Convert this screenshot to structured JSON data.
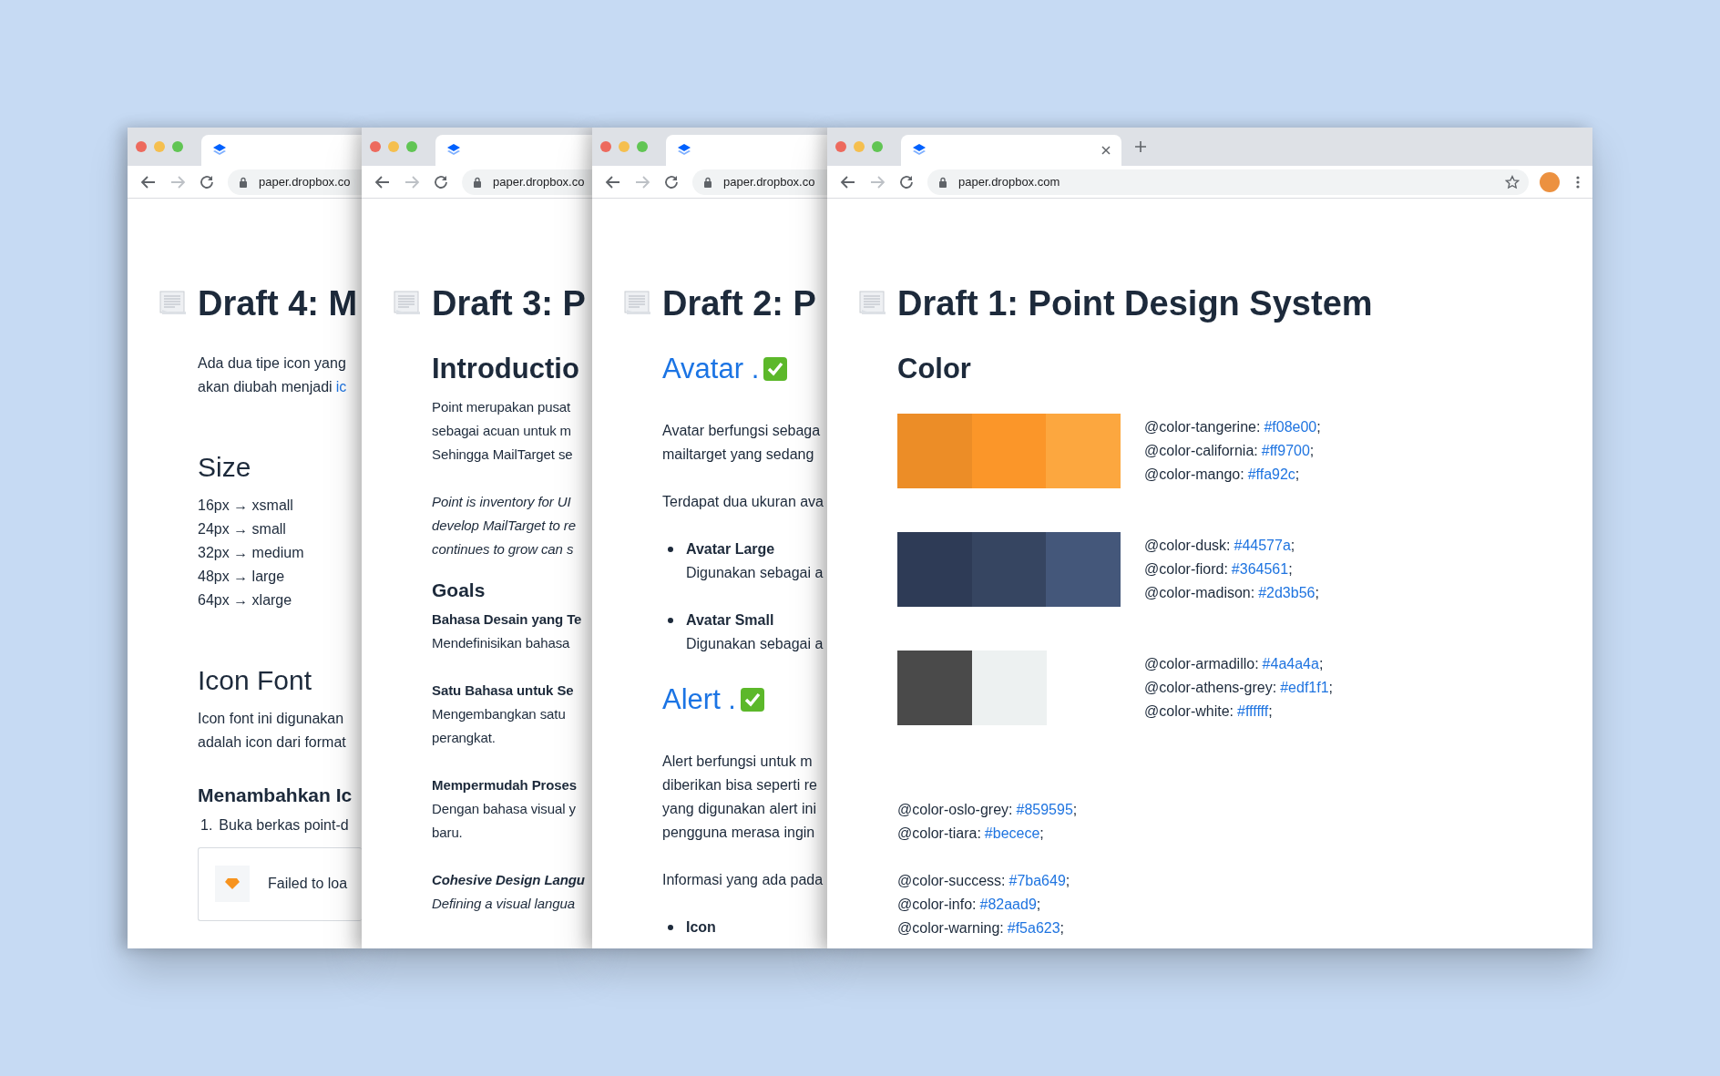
{
  "windows": [
    {
      "active": false,
      "can_go_forward": false,
      "address": "paper.dropbox.co",
      "title": "Draft 4: M",
      "blocks": [
        {
          "kind": "para",
          "lines": [
            "Ada dua tipe icon yang",
            "akan diubah menjadi"
          ],
          "link": "ic"
        },
        {
          "kind": "h2-light",
          "text": "Size"
        },
        {
          "kind": "lines",
          "items": [
            "16px → xsmall",
            "24px → small",
            "32px → medium",
            "48px → large",
            "64px → xlarge"
          ]
        },
        {
          "kind": "h2-light",
          "text": "Icon Font"
        },
        {
          "kind": "para",
          "lines": [
            "Icon font ini digunakan",
            "adalah icon dari format"
          ]
        },
        {
          "kind": "h3",
          "text": "Menambahkan Ic"
        },
        {
          "kind": "ol",
          "number": "1.",
          "text": "Buka berkas point-d"
        },
        {
          "kind": "embed",
          "text": "Failed to loa"
        }
      ]
    },
    {
      "active": false,
      "can_go_forward": false,
      "address": "paper.dropbox.co",
      "title": "Draft 3: P",
      "blocks": [
        {
          "kind": "h2",
          "text": "Introductio"
        },
        {
          "kind": "para",
          "lines": [
            "Point merupakan pusat",
            "sebagai acuan untuk m",
            "Sehingga MailTarget se"
          ]
        },
        {
          "kind": "para",
          "italic": true,
          "lines": [
            "Point is inventory for UI",
            "develop MailTarget to re",
            "continues to grow can s"
          ]
        },
        {
          "kind": "h3",
          "text": "Goals"
        },
        {
          "kind": "para",
          "lines": [
            "**Bahasa Desain yang Te**",
            "Mendefinisikan bahasa"
          ]
        },
        {
          "kind": "para",
          "lines": [
            "**Satu Bahasa untuk Se**",
            "Mengembangkan satu",
            "perangkat."
          ]
        },
        {
          "kind": "para",
          "lines": [
            "**Mempermudah Proses**",
            "Dengan bahasa visual y",
            "baru."
          ]
        },
        {
          "kind": "para",
          "italic": true,
          "lines": [
            "**Cohesive Design Langu**",
            "Defining a visual langua"
          ]
        }
      ]
    },
    {
      "active": false,
      "can_go_forward": false,
      "address": "paper.dropbox.co",
      "title": "Draft 2: P",
      "blocks": [
        {
          "kind": "h2-accent",
          "text": "Avatar .",
          "done": true
        },
        {
          "kind": "para",
          "lines": [
            "Avatar berfungsi sebaga",
            "mailtarget yang sedang"
          ]
        },
        {
          "kind": "para",
          "lines": [
            "Terdapat dua ukuran ava"
          ]
        },
        {
          "kind": "bullet",
          "title": "Avatar Large",
          "lines": [
            "Digunakan sebagai a"
          ]
        },
        {
          "kind": "bullet",
          "title": "Avatar Small",
          "lines": [
            "Digunakan sebagai a"
          ]
        },
        {
          "kind": "h2-accent",
          "text": "Alert .",
          "done": true
        },
        {
          "kind": "para",
          "lines": [
            "Alert berfungsi untuk m",
            "diberikan bisa seperti re",
            "yang digunakan alert ini",
            "pengguna merasa ingin"
          ]
        },
        {
          "kind": "para",
          "lines": [
            "Informasi yang ada pada"
          ]
        },
        {
          "kind": "bullet",
          "title": "Icon"
        }
      ]
    },
    {
      "active": true,
      "can_go_forward": false,
      "address": "paper.dropbox.com",
      "title": "Draft 1: Point Design System",
      "blocks": [
        {
          "kind": "h2",
          "text": "Color"
        },
        {
          "kind": "swatch_row",
          "swatches": [
            {
              "color": "#ec8d27"
            },
            {
              "color": "#fb9629"
            },
            {
              "color": "#fca73f"
            }
          ],
          "vars": [
            {
              "label": "@color-tangerine:",
              "value": "#f08e00",
              "end": ";"
            },
            {
              "label": "@color-california:",
              "value": "#ff9700",
              "end": ";"
            },
            {
              "label": "@color-mango:",
              "value": "#ffa92c",
              "end": ";"
            }
          ]
        },
        {
          "kind": "swatch_row",
          "swatches": [
            {
              "color": "#2e3b56"
            },
            {
              "color": "#364561"
            },
            {
              "color": "#44577a"
            }
          ],
          "vars": [
            {
              "label": "@color-dusk:",
              "value": "#44577a",
              "end": ";"
            },
            {
              "label": "@color-fiord:",
              "value": "#364561",
              "end": ";"
            },
            {
              "label": "@color-madison:",
              "value": "#2d3b56",
              "end": ";"
            }
          ]
        },
        {
          "kind": "swatch_row",
          "swatches": [
            {
              "color": "#4a4a4a"
            },
            {
              "color": "#edf1f1"
            }
          ],
          "vars": [
            {
              "label": "@color-armadillo:",
              "value": "#4a4a4a",
              "end": ";"
            },
            {
              "label": "@color-athens-grey:",
              "value": "#edf1f1",
              "end": ";"
            },
            {
              "label": "@color-white:",
              "value": "#ffffff",
              "end": ";"
            }
          ]
        },
        {
          "kind": "vars",
          "vars": [
            {
              "label": "@color-oslo-grey:",
              "value": "#859595",
              "end": ";"
            },
            {
              "label": "@color-tiara:",
              "value": "#becece",
              "end": ";"
            }
          ]
        },
        {
          "kind": "vars",
          "vars": [
            {
              "label": "@color-success:",
              "value": "#7ba649",
              "end": ";"
            },
            {
              "label": "@color-info:",
              "value": "#82aad9",
              "end": ";"
            },
            {
              "label": "@color-warning:",
              "value": "#f5a623",
              "end": ";"
            }
          ]
        }
      ]
    }
  ]
}
